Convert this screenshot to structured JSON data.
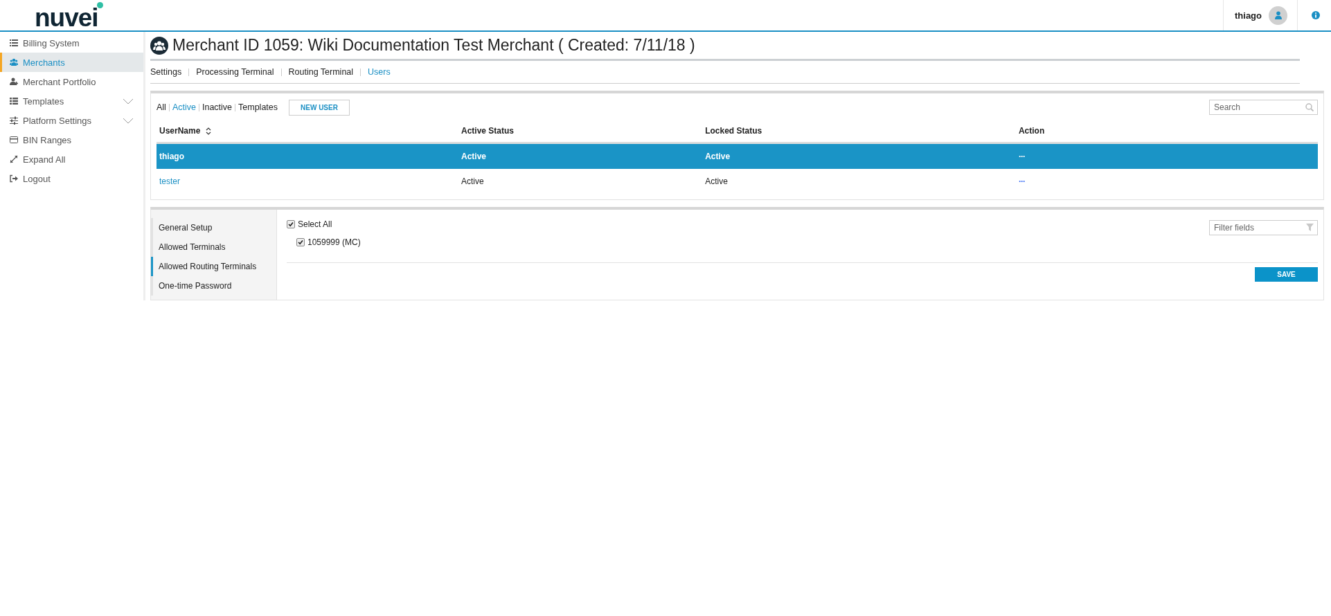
{
  "header": {
    "logo": "nuvei",
    "user": "thiago"
  },
  "sidebar": {
    "items": [
      {
        "label": "Billing System",
        "selected": false,
        "expandable": false
      },
      {
        "label": "Merchants",
        "selected": true,
        "expandable": false
      },
      {
        "label": "Merchant Portfolio",
        "selected": false,
        "expandable": false
      },
      {
        "label": "Templates",
        "selected": false,
        "expandable": true
      },
      {
        "label": "Platform Settings",
        "selected": false,
        "expandable": true
      },
      {
        "label": "BIN Ranges",
        "selected": false,
        "expandable": false
      },
      {
        "label": "Expand All",
        "selected": false,
        "expandable": false
      },
      {
        "label": "Logout",
        "selected": false,
        "expandable": false
      }
    ]
  },
  "page": {
    "title": "Merchant ID 1059: Wiki Documentation Test Merchant ( Created: 7/11/18 )"
  },
  "tabs": [
    {
      "label": "Settings",
      "selected": false
    },
    {
      "label": "Processing Terminal",
      "selected": false
    },
    {
      "label": "Routing Terminal",
      "selected": false
    },
    {
      "label": "Users",
      "selected": true
    }
  ],
  "users": {
    "filters": [
      {
        "label": "All",
        "selected": false
      },
      {
        "label": "Active",
        "selected": true
      },
      {
        "label": "Inactive",
        "selected": false
      },
      {
        "label": "Templates",
        "selected": false
      }
    ],
    "new_button": "NEW USER",
    "search": {
      "placeholder": "Search"
    },
    "columns": [
      {
        "label": "UserName",
        "sortable": true
      },
      {
        "label": "Active Status",
        "sortable": false
      },
      {
        "label": "Locked Status",
        "sortable": false
      },
      {
        "label": "Action",
        "sortable": false
      }
    ],
    "rows": [
      {
        "username": "thiago",
        "active_status": "Active",
        "locked_status": "Active",
        "action": "···",
        "selected": true
      },
      {
        "username": "tester",
        "active_status": "Active",
        "locked_status": "Active",
        "action": "···",
        "selected": false
      }
    ]
  },
  "user_settings": {
    "nav": [
      {
        "label": "General Setup",
        "selected": false
      },
      {
        "label": "Allowed Terminals",
        "selected": false
      },
      {
        "label": "Allowed Routing Terminals",
        "selected": true
      },
      {
        "label": "One-time Password",
        "selected": false
      }
    ],
    "filter": {
      "placeholder": "Filter fields"
    },
    "checkboxes": [
      {
        "label": "Select All",
        "checked": true,
        "children": [
          {
            "label": "1059999 (MC)",
            "checked": true
          }
        ]
      }
    ],
    "save_button": "SAVE"
  }
}
